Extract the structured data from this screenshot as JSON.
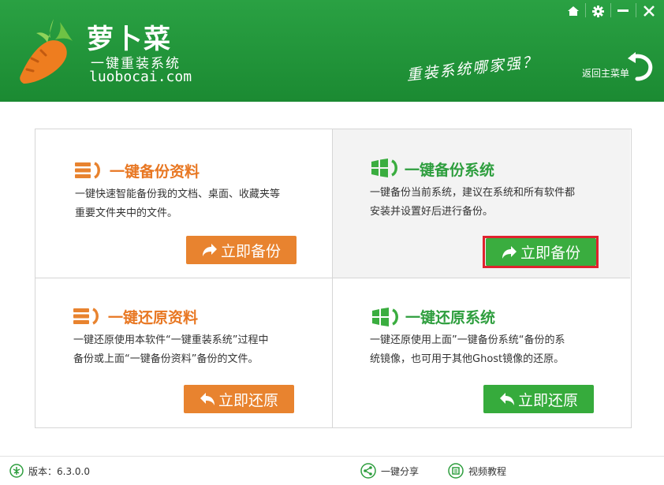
{
  "header": {
    "logo_title": "萝卜菜",
    "logo_subtitle": "一键重装系统",
    "logo_url": "luobocai.com",
    "slogan": "重装系统哪家强？",
    "return_menu_label": "返回主菜单",
    "brand_color": "#1f8f35"
  },
  "window_controls": [
    "home-icon",
    "gear-icon",
    "minimize-icon",
    "close-icon"
  ],
  "cards": {
    "backup_data": {
      "title": "一键备份资料",
      "desc_line1": "一键快速智能备份我的文档、桌面、收藏夹等",
      "desc_line2": "重要文件夹中的文件。",
      "button": "立即备份"
    },
    "backup_system": {
      "title": "一键备份系统",
      "desc_line1": "一键备份当前系统，建议在系统和所有软件都",
      "desc_line2": "安装并设置好后进行备份。",
      "button": "立即备份"
    },
    "restore_data": {
      "title": "一键还原资料",
      "desc_line1": "一键还原使用本软件“一键重装系统”过程中",
      "desc_line2": "备份或上面“一键备份资料”备份的文件。",
      "button": "立即还原"
    },
    "restore_system": {
      "title": "一键还原系统",
      "desc_line1": "一键还原使用上面”一键备份系统“备份的系",
      "desc_line2": "统镜像，也可用于其他Ghost镜像的还原。",
      "button": "立即还原"
    }
  },
  "colors": {
    "orange": "#e8832f",
    "green": "#3aad3f",
    "highlight": "#e0222e"
  },
  "footer": {
    "version": "版本：6.3.0.0",
    "share": "一键分享",
    "tutorial": "视频教程"
  }
}
